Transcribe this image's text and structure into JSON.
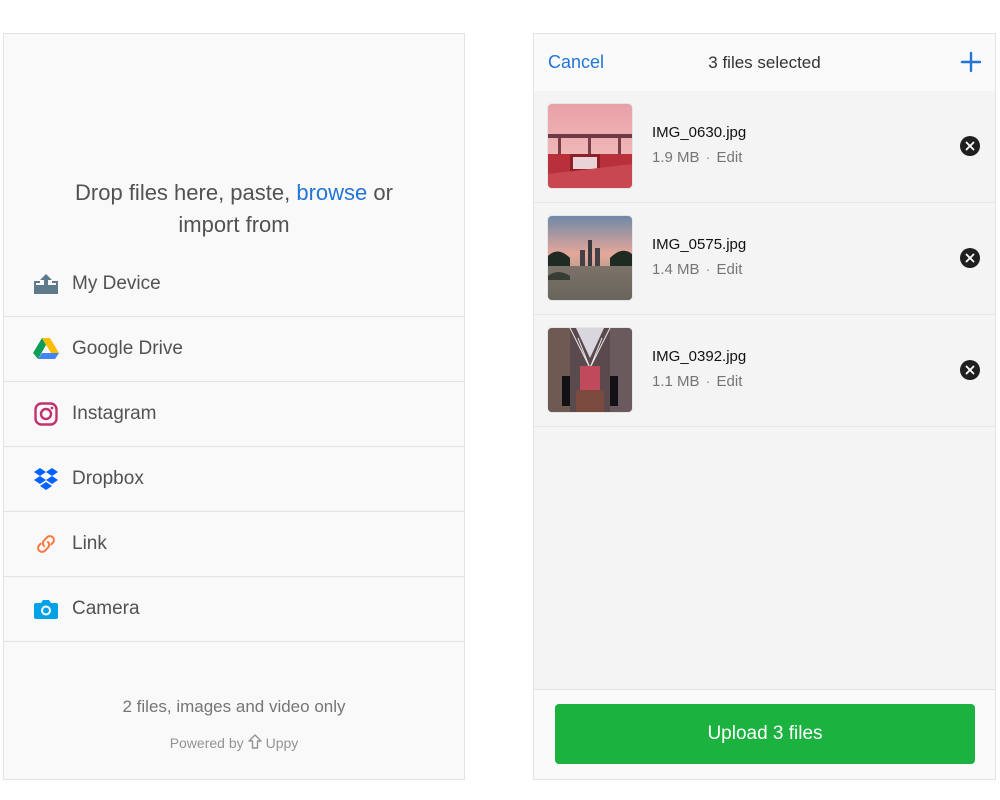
{
  "left": {
    "drop_text_part1": "Drop files here, paste, ",
    "browse_label": "browse",
    "drop_text_part2": " or",
    "drop_text_line2": "import from",
    "providers": [
      {
        "label": "My Device",
        "icon": "upload-device-icon"
      },
      {
        "label": "Google Drive",
        "icon": "google-drive-icon"
      },
      {
        "label": "Instagram",
        "icon": "instagram-icon"
      },
      {
        "label": "Dropbox",
        "icon": "dropbox-icon"
      },
      {
        "label": "Link",
        "icon": "link-icon"
      },
      {
        "label": "Camera",
        "icon": "camera-icon"
      }
    ],
    "note": "2 files, images and video only",
    "powered_by": "Powered by",
    "brand": "Uppy"
  },
  "right": {
    "cancel_label": "Cancel",
    "title": "3 files selected",
    "add_icon": "plus-icon",
    "files": [
      {
        "name": "IMG_0630.jpg",
        "size": "1.9 MB",
        "separator": "·",
        "edit": "Edit"
      },
      {
        "name": "IMG_0575.jpg",
        "size": "1.4 MB",
        "separator": "·",
        "edit": "Edit"
      },
      {
        "name": "IMG_0392.jpg",
        "size": "1.1 MB",
        "separator": "·",
        "edit": "Edit"
      }
    ],
    "upload_label": "Upload 3 files"
  },
  "colors": {
    "accent_blue": "#2275d7",
    "upload_green": "#1bb240"
  }
}
